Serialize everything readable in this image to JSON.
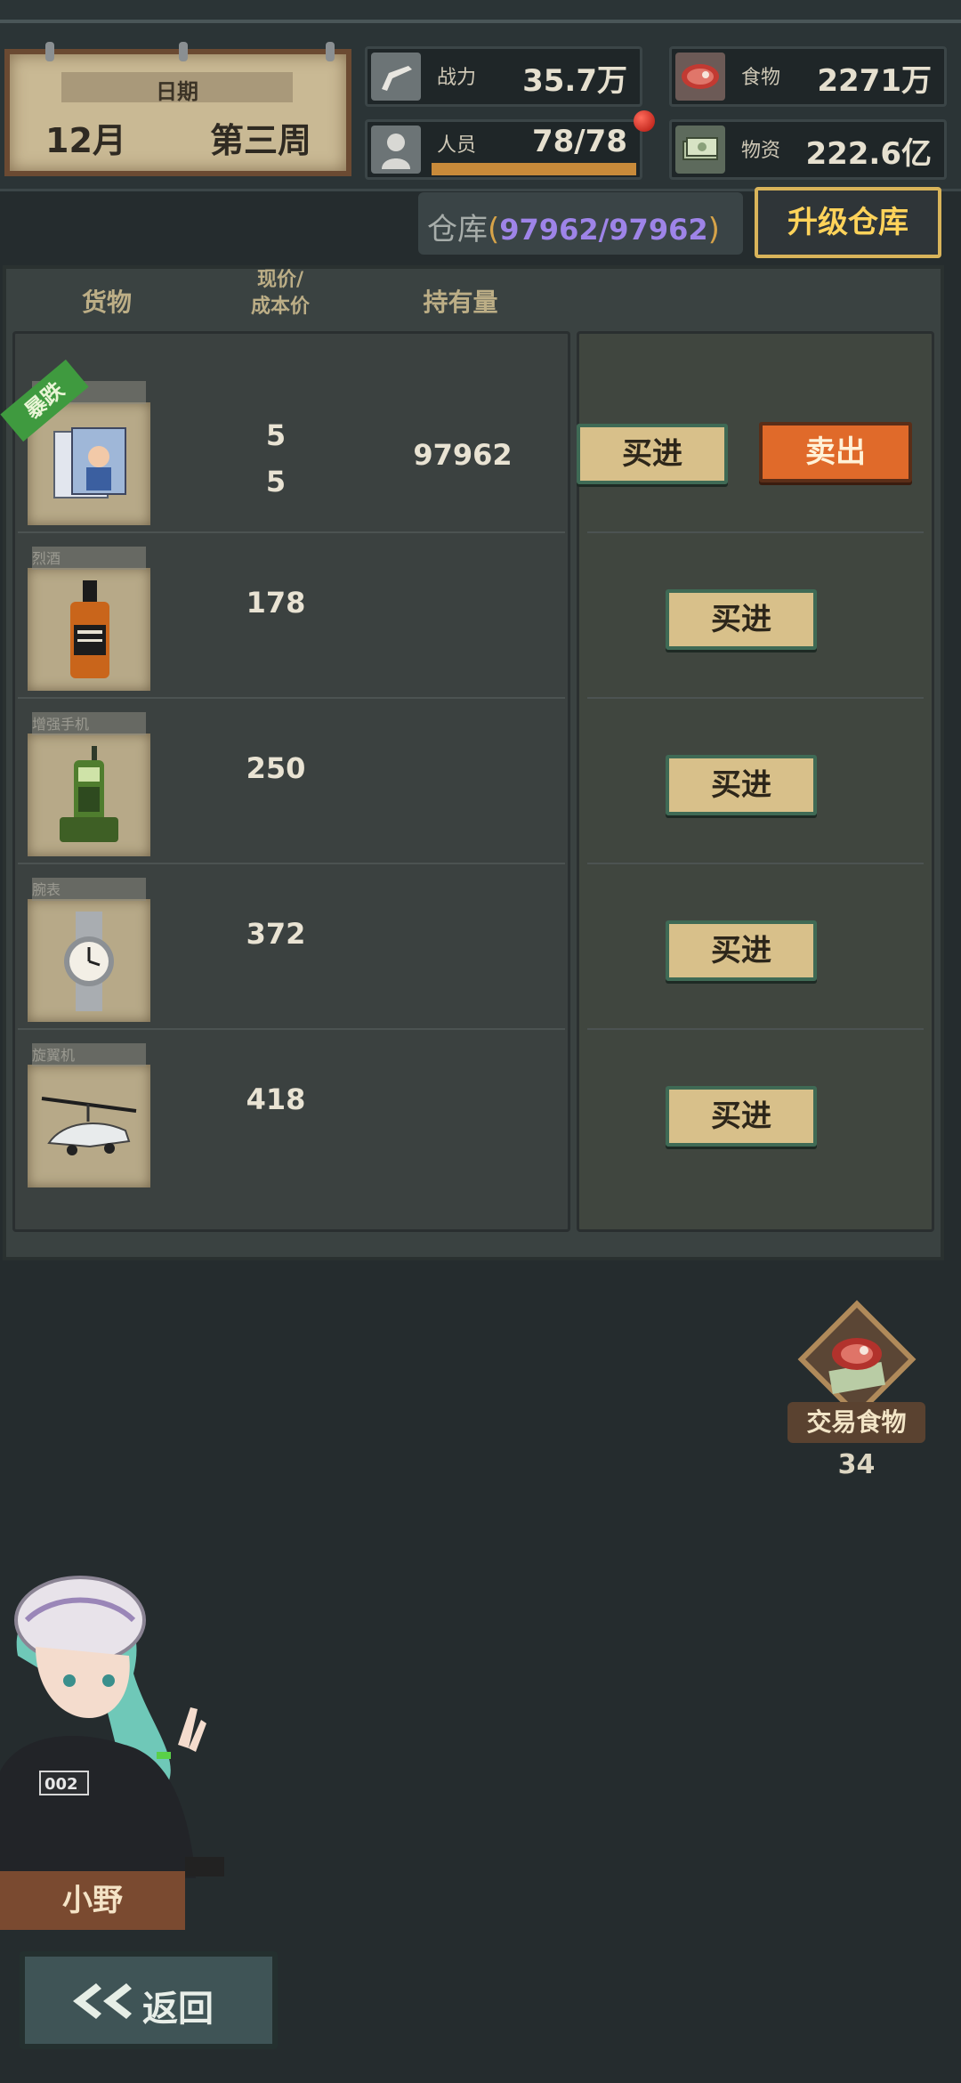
{
  "date": {
    "label": "日期",
    "month": "12月",
    "week": "第三周"
  },
  "stats": {
    "power": {
      "label": "战力",
      "value": "35.7万",
      "icon": "gun-icon"
    },
    "food": {
      "label": "食物",
      "value": "2271万",
      "icon": "meat-icon"
    },
    "staff": {
      "label": "人员",
      "value": "78/78",
      "icon": "person-icon",
      "fill": 1.0
    },
    "supplies": {
      "label": "物资",
      "value": "222.6亿",
      "icon": "money-icon"
    }
  },
  "warehouse": {
    "label": "仓库",
    "open": "(",
    "count": "97962/97962",
    "close": ")"
  },
  "upgrade_label": "升级仓库",
  "table": {
    "headers": {
      "goods": "货物",
      "price_line1": "现价/",
      "price_line2": "成本价",
      "holding": "持有量"
    },
    "rows": [
      {
        "tag": "漫画书",
        "badge": "暴跌",
        "price": "5",
        "cost": "5",
        "holding": "97962",
        "buy": "买进",
        "sell": "卖出",
        "icon": "comic-book-icon"
      },
      {
        "tag": "烈酒",
        "price": "178",
        "buy": "买进",
        "icon": "whiskey-bottle-icon"
      },
      {
        "tag": "增强手机",
        "price": "250",
        "buy": "买进",
        "icon": "radio-phone-icon"
      },
      {
        "tag": "腕表",
        "price": "372",
        "buy": "买进",
        "icon": "wristwatch-icon"
      },
      {
        "tag": "旋翼机",
        "price": "418",
        "buy": "买进",
        "icon": "gyrocopter-icon"
      }
    ]
  },
  "trade": {
    "label": "交易食物",
    "count": "34",
    "icon": "meat-trade-icon"
  },
  "character": {
    "name": "小野",
    "jersey": "002"
  },
  "back_label": "返回",
  "colors": {
    "accent": "#d9b45a",
    "sell": "#e06a2a",
    "buy": "#d8c08a",
    "badge": "#3f9a3f",
    "warehouse_count": "#9e84e8"
  }
}
